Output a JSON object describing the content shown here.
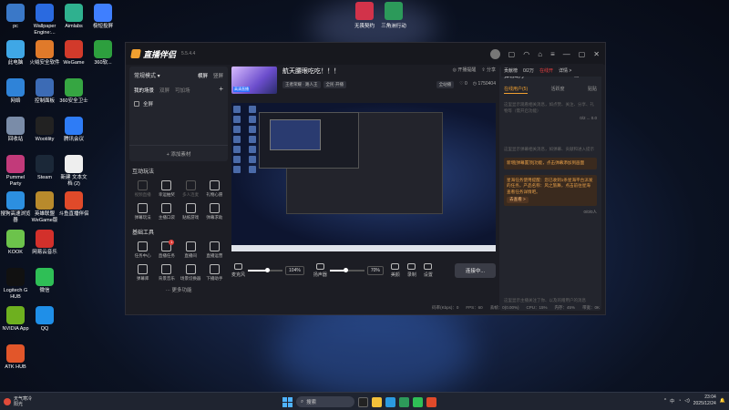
{
  "desktop": {
    "icons": [
      {
        "label": "pc",
        "color": "#3a78c8"
      },
      {
        "label": "Wallpaper Engine:...",
        "color": "#2a6ae0"
      },
      {
        "label": "Aimlabs",
        "color": "#2fb18f"
      },
      {
        "label": "极短投屏",
        "color": "#3f7fff"
      },
      {
        "label": "此电脑",
        "color": "#3fa7e6"
      },
      {
        "label": "火绒安全软件",
        "color": "#e07a2a"
      },
      {
        "label": "WeGame",
        "color": "#d23a2b"
      },
      {
        "label": "360软...",
        "color": "#2d9f3e"
      },
      {
        "label": "网络",
        "color": "#2f83d8"
      },
      {
        "label": "控制面板",
        "color": "#3c6bb5"
      },
      {
        "label": "360安全卫士",
        "color": "#36a642"
      },
      {
        "label": "回收站",
        "color": "#7a8ca8"
      },
      {
        "label": "Wootility",
        "color": "#222"
      },
      {
        "label": "腾讯会议",
        "color": "#2e7cf6"
      },
      {
        "label": "Pummel Party",
        "color": "#c23a7a"
      },
      {
        "label": "Steam",
        "color": "#1b2838"
      },
      {
        "label": "新建 文本文档 (2)",
        "color": "#eeeeee"
      },
      {
        "label": "搜狗高速浏览器",
        "color": "#2c8fe0"
      },
      {
        "label": "英雄联盟WeGame版",
        "color": "#b88a2c"
      },
      {
        "label": "斗鱼直播伴侣",
        "color": "#e04a2a"
      },
      {
        "label": "KOOK",
        "color": "#6cc34b"
      },
      {
        "label": "网易云音乐",
        "color": "#d3302b"
      },
      {
        "label": "Logitech G HUB",
        "color": "#111"
      },
      {
        "label": "微信",
        "color": "#2fbf56"
      },
      {
        "label": "NVIDIA App",
        "color": "#6eb01f"
      },
      {
        "label": "QQ",
        "color": "#1f8fe8"
      },
      {
        "label": "ATK HUB",
        "color": "#e2562a"
      }
    ],
    "top_icons": [
      {
        "label": "无畏契约",
        "color": "#d2334a"
      },
      {
        "label": "三角洲行动",
        "color": "#2c9a5a"
      }
    ]
  },
  "app": {
    "name": "直播伴侣",
    "version": "5.5.4.4",
    "scene": {
      "mode": "常规模式",
      "orient_a": "横屏",
      "orient_b": "竖屏",
      "tabs": [
        "我的场景",
        "双屏",
        "可加场"
      ],
      "items": [
        "全屏"
      ],
      "add_source": "+ 添加素材"
    },
    "interactive": {
      "title": "互动玩法",
      "items": [
        "视频直播",
        "幸运抽奖",
        "多人连麦",
        "礼物心愿",
        "弹幕玩法",
        "主播口袋",
        "贴纸游戏",
        "弹幕求助"
      ]
    },
    "tools": {
      "title": "基础工具",
      "items": [
        "任务中心",
        "直播任务",
        "直播间",
        "直播运营",
        "弹幕库",
        "背景音乐",
        "场景切换器",
        "下播助手"
      ],
      "more": "··· 更多功能"
    },
    "stream": {
      "title": "航天腰眼吃吃！！！",
      "tags": [
        "王者荣耀 · 路人王",
        "全民·开播"
      ],
      "start": "开播提醒",
      "share": "分享",
      "platform": "全站播",
      "likes": "0",
      "viewers": "1750404",
      "cover_tag": "高清直播"
    },
    "controls": {
      "mic": "麦克风",
      "mic_pct": "104%",
      "speaker": "扬声器",
      "speaker_pct": "70%",
      "mic_level": 0.55,
      "speaker_level": 0.45,
      "buttons": [
        "美颜",
        "录制",
        "设置"
      ],
      "connect": "连接中..."
    },
    "stats": [
      "码率(Kbps)：0",
      "FPS：60",
      "丢帧：0(0.00%)",
      "CPU：15%",
      "内存：45%",
      "带宽：0K"
    ],
    "chat": {
      "top": [
        "贡献榜",
        "0/2万",
        "在线开",
        "详情 >"
      ],
      "title": "弹幕助手",
      "tabs": [
        "在线用户(5)",
        "活跃度",
        "贴贴"
      ],
      "msg1": "这里显示观看相关消息，如点赞、关注、分享、礼物等（需开启功能）",
      "count": "0/2 ... 0.0",
      "msg2": "这里显示弹幕相关消息，如弹幕、贡献和进入提示",
      "notice1": "新增[弹幕置顶]功能，点击弹幕添加到画面",
      "notice2": "星海任务使用提醒：您已收到1条星海平台派发的任务，产品名称：风之旅舞，点击前往星海查看任务详情吧。",
      "notice_link": "去查看 >",
      "count2": "0/0/0人",
      "input": "这里显示主播关注了你、以及的赠用户的消息"
    }
  },
  "taskbar": {
    "weather_temp": "天气寒冷",
    "weather_sub": "阳光",
    "search": "搜索",
    "time": "23:04",
    "date": "2025/12/24",
    "lang": "中"
  }
}
